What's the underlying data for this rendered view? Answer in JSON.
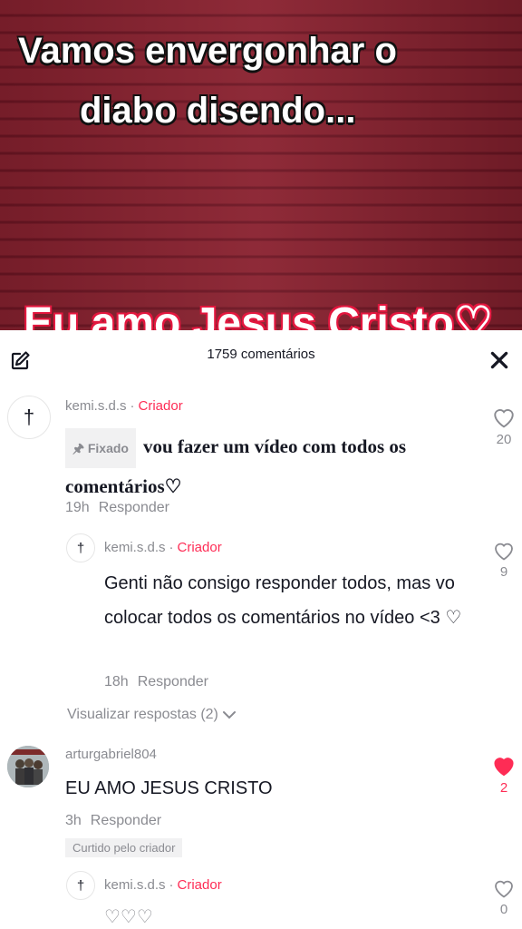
{
  "video": {
    "overlay_line1": "Vamos envergonhar o",
    "overlay_line2": "diabo disendo...",
    "bottom_text": "Eu amo Jesus Cristo♡"
  },
  "comments_panel": {
    "count_label": "1759 comentários",
    "comments": [
      {
        "avatar_glyph": "†",
        "username": "kemi.s.d.s",
        "creator_label": "Criador",
        "pinned_label": "Fixado",
        "text": "vou fazer um vídeo com todos os comentários♡",
        "time": "19h",
        "reply_label": "Responder",
        "likes": "20",
        "replies": [
          {
            "avatar_glyph": "†",
            "username": "kemi.s.d.s",
            "creator_label": "Criador",
            "text": "Genti não consigo responder todos, mas vo colocar todos os comentários no vídeo <3 ♡",
            "time": "18h",
            "reply_label": "Responder",
            "likes": "9"
          }
        ],
        "view_replies": "Visualizar respostas (2)"
      },
      {
        "username": "arturgabriel804",
        "text": "EU AMO JESUS CRISTO",
        "time": "3h",
        "reply_label": "Responder",
        "liked_by_creator": "Curtido pelo criador",
        "likes": "2",
        "liked": true,
        "replies": [
          {
            "avatar_glyph": "†",
            "username": "kemi.s.d.s",
            "creator_label": "Criador",
            "text": "♡♡♡",
            "likes": "0"
          }
        ]
      }
    ]
  },
  "colors": {
    "accent": "#fe2c55",
    "muted": "#8a8b91",
    "text": "#161823"
  },
  "icons": [
    "edit-icon",
    "close-icon",
    "heart-icon",
    "heart-filled-icon",
    "pin-icon",
    "chevron-down-icon",
    "cross-icon"
  ]
}
